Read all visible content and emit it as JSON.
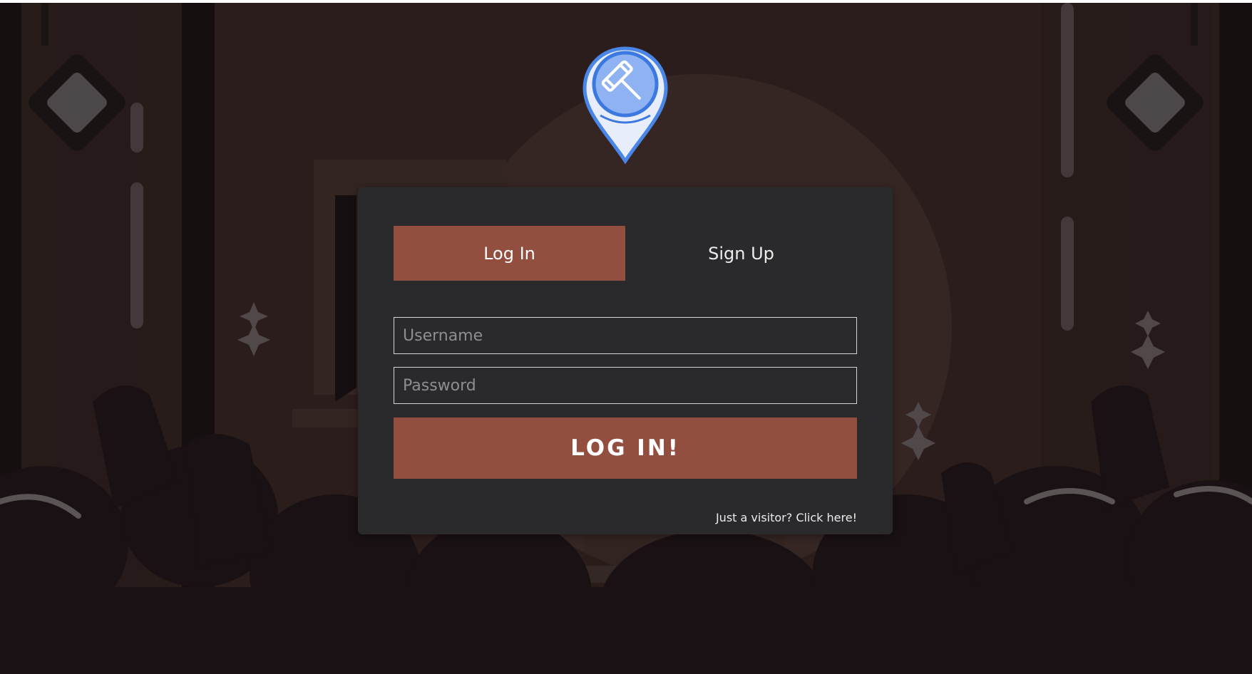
{
  "logo": {
    "icon": "gavel-map-pin-icon"
  },
  "tabs": [
    {
      "label": "Log In",
      "active": true
    },
    {
      "label": "Sign Up",
      "active": false
    }
  ],
  "form": {
    "username_placeholder": "Username",
    "password_placeholder": "Password",
    "submit_label": "LOG IN!"
  },
  "visitor_link": "Just a visitor? Click here!",
  "colors": {
    "accent": "#924e3f",
    "card": "#2a2a2d",
    "background": "#2a1e1c",
    "logo_blue": "#4a86e8"
  }
}
